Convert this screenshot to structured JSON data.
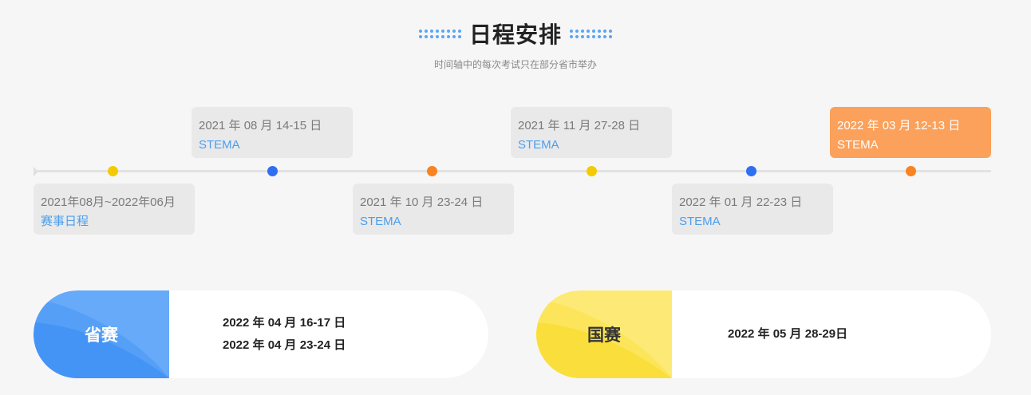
{
  "header": {
    "title": "日程安排",
    "subtitle": "时间轴中的每次考试只在部分省市举办"
  },
  "timeline": {
    "cards": [
      {
        "date": "2021年08月~2022年06月",
        "event": "赛事日程"
      },
      {
        "date": "2021 年 08 月 14-15 日",
        "event": "STEMA"
      },
      {
        "date": "2021 年 10 月 23-24 日",
        "event": "STEMA"
      },
      {
        "date": "2021 年 11 月 27-28 日",
        "event": "STEMA"
      },
      {
        "date": "2022 年 01 月 22-23 日",
        "event": "STEMA"
      },
      {
        "date": "2022 年 03 月 12-13 日",
        "event": "STEMA"
      }
    ],
    "dot_colors": [
      "#f2cb05",
      "#2f6ff0",
      "#f98221",
      "#f2cb05",
      "#2f6ff0",
      "#f98221"
    ]
  },
  "competitions": {
    "provincial": {
      "label": "省赛",
      "dates": [
        "2022 年 04 月 16-17 日",
        "2022 年 04 月 23-24 日"
      ],
      "color": "#4a9bf8"
    },
    "national": {
      "label": "国赛",
      "dates": [
        "2022 年 05 月 28-29日"
      ],
      "color": "#fbe04a"
    }
  }
}
